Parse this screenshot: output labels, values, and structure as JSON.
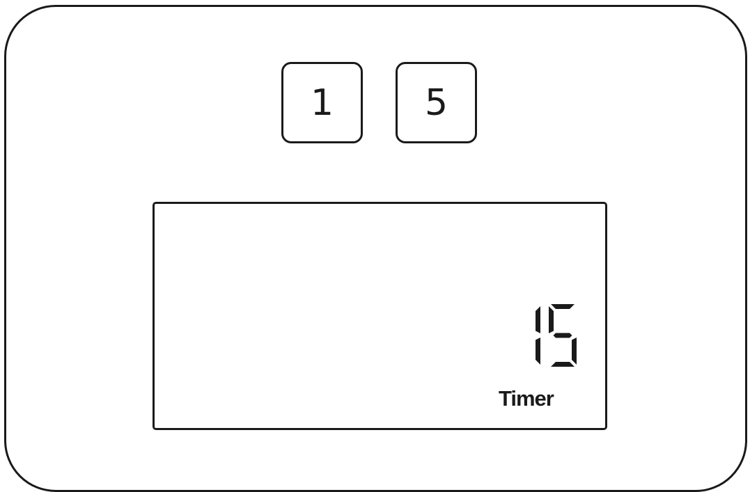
{
  "keypad": {
    "keys": [
      {
        "label": "1"
      },
      {
        "label": "5"
      }
    ]
  },
  "display": {
    "readout": "15",
    "mode_label": "Timer"
  },
  "colors": {
    "ink": "#1a1a1a",
    "background": "#ffffff"
  }
}
